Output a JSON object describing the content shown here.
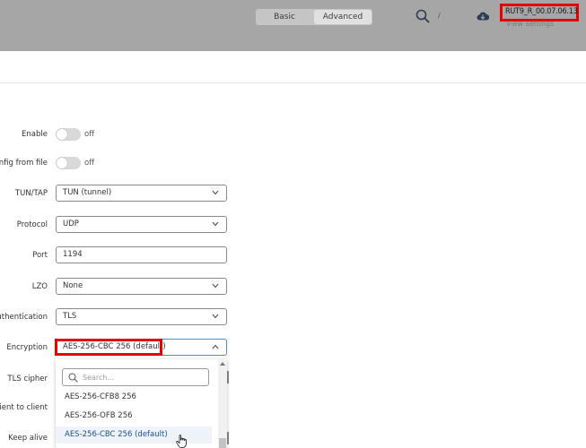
{
  "header": {
    "mode_basic": "Basic",
    "mode_advanced": "Advanced",
    "slash": "/",
    "firmware": "RUT9_R_00.07.06.13",
    "firmware_sub": "View settings"
  },
  "form": {
    "enable_label": "Enable",
    "enable_state": "off",
    "config_label": "onfig from file",
    "config_state": "off",
    "tuntap_label": "TUN/TAP",
    "tuntap_value": "TUN (tunnel)",
    "protocol_label": "Protocol",
    "protocol_value": "UDP",
    "port_label": "Port",
    "port_value": "1194",
    "lzo_label": "LZO",
    "lzo_value": "None",
    "auth_label": "uthentication",
    "auth_value": "TLS",
    "encryption_label": "Encryption",
    "encryption_value": "AES-256-CBC 256 (default)",
    "tls_cipher_label": "TLS cipher",
    "client_label": "Client to client",
    "keepalive_label": "Keep alive"
  },
  "dropdown": {
    "search_placeholder": "Search...",
    "items": [
      "AES-256-CFB8 256",
      "AES-256-OFB 256",
      "AES-256-CBC 256 (default)"
    ]
  },
  "colors": {
    "highlight": "#e60000",
    "focus": "#4a8fd9"
  }
}
